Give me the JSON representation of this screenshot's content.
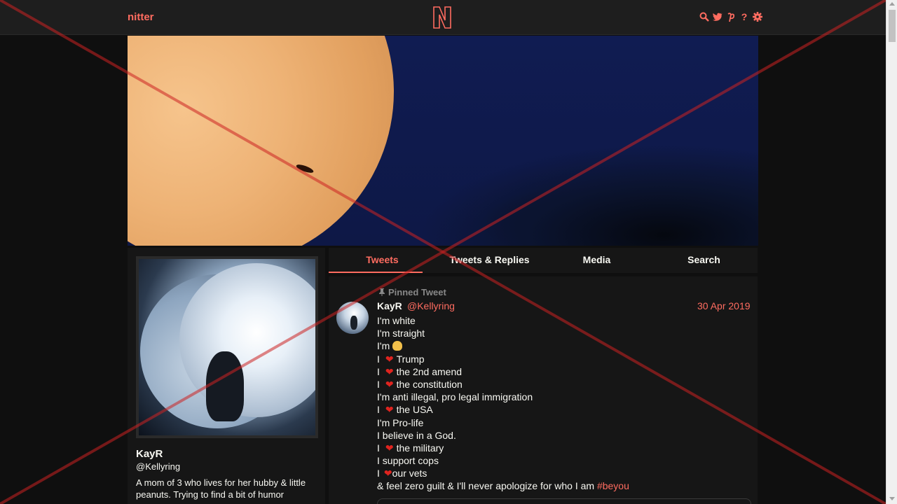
{
  "nav": {
    "brand": "nitter",
    "logo_letter": "N",
    "icons": [
      "search-icon",
      "twitter-icon",
      "rss-icon",
      "help-icon",
      "gear-icon"
    ]
  },
  "tabs": [
    {
      "label": "Tweets",
      "active": true
    },
    {
      "label": "Tweets & Replies",
      "active": false
    },
    {
      "label": "Media",
      "active": false
    },
    {
      "label": "Search",
      "active": false
    }
  ],
  "profile": {
    "name": "KayR",
    "handle": "@Kellyring",
    "bio": "A mom of 3 who lives for her hubby & little peanuts. Trying to find a bit of humor"
  },
  "tweet": {
    "pinned_label": "Pinned Tweet",
    "author_name": "KayR",
    "author_handle": "@Kellyring",
    "date": "30 Apr 2019",
    "lines": [
      "I'm white",
      "I'm straight",
      "I'm",
      "Trump",
      "the 2nd amend",
      "the constitution",
      "I'm anti illegal, pro legal immigration",
      "the USA",
      "I'm Pro-life",
      "I believe in a God.",
      "the military",
      "I support cops",
      "our vets",
      "& feel zero guilt & I'll never apologize for who I am",
      "#beyou"
    ]
  },
  "colors": {
    "accent": "#ff6c60",
    "background": "#0f0f0f",
    "panel": "#161616",
    "overlay_x": "#cc2222"
  }
}
